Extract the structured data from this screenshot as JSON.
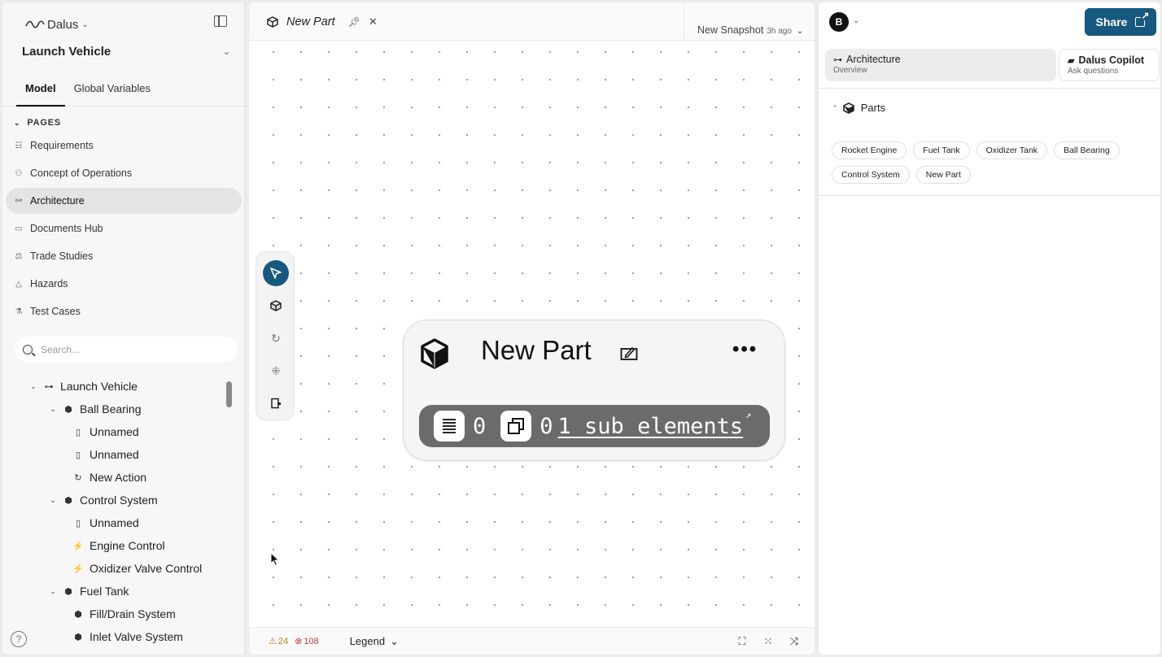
{
  "sidebar": {
    "brand": "Dalus",
    "project": "Launch Vehicle",
    "tabs": [
      "Model",
      "Global Variables"
    ],
    "pages_header": "PAGES",
    "pages": [
      {
        "label": "Requirements",
        "icon": "requirements-icon"
      },
      {
        "label": "Concept of Operations",
        "icon": "people-icon"
      },
      {
        "label": "Architecture",
        "icon": "architecture-icon",
        "active": true
      },
      {
        "label": "Documents Hub",
        "icon": "folder-icon"
      },
      {
        "label": "Trade Studies",
        "icon": "scale-icon"
      },
      {
        "label": "Hazards",
        "icon": "warning-icon"
      },
      {
        "label": "Test Cases",
        "icon": "flask-icon"
      }
    ],
    "search_placeholder": "Search...",
    "tree": [
      {
        "label": "Launch Vehicle",
        "icon": "hierarchy-icon"
      },
      {
        "label": "Ball Bearing",
        "icon": "cube-icon"
      },
      {
        "label": "Unnamed",
        "icon": "port-icon"
      },
      {
        "label": "Unnamed",
        "icon": "port-icon"
      },
      {
        "label": "New Action",
        "icon": "action-icon"
      },
      {
        "label": "Control System",
        "icon": "cube-icon"
      },
      {
        "label": "Unnamed",
        "icon": "port-icon"
      },
      {
        "label": "Engine Control",
        "icon": "function-icon"
      },
      {
        "label": "Oxidizer Valve Control",
        "icon": "function-icon"
      },
      {
        "label": "Fuel Tank",
        "icon": "cube-icon"
      },
      {
        "label": "Fill/Drain System",
        "icon": "cube-icon"
      },
      {
        "label": "Inlet Valve System",
        "icon": "cube-icon"
      }
    ],
    "help": "?"
  },
  "canvas": {
    "tab_title": "New Part",
    "snapshot_label": "New Snapshot",
    "snapshot_time": "3h ago",
    "node": {
      "title": "New Part",
      "requirements_count": "0",
      "instances_count": "0",
      "sub_elements": "1 sub elements"
    },
    "warnings": "24",
    "errors": "108",
    "legend": "Legend"
  },
  "right": {
    "avatar": "B",
    "share": "Share",
    "tabs": [
      {
        "title": "Architecture",
        "subtitle": "Overview"
      },
      {
        "title": "Dalus Copilot",
        "subtitle": "Ask questions"
      }
    ],
    "parts_header": "Parts",
    "parts": [
      "Rocket Engine",
      "Fuel Tank",
      "Oxidizer Tank",
      "Ball Bearing",
      "Control System",
      "New Part"
    ]
  },
  "colors": {
    "accent": "#17587e",
    "node_bar": "#6b6b6b",
    "warning": "#c07a12",
    "error": "#c23a3a"
  }
}
